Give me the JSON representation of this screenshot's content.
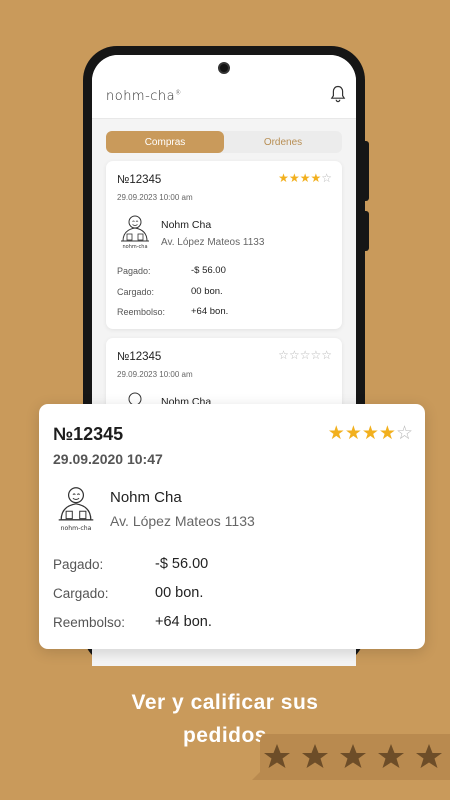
{
  "app": {
    "logo_text": "nohm-cha"
  },
  "tabs": [
    {
      "label": "Compras",
      "active": true
    },
    {
      "label": "Ordenes",
      "active": false
    }
  ],
  "orders": [
    {
      "number": "№12345",
      "rating": 4,
      "date": "29.09.2023 10:00 am",
      "shop": "Nohm Cha",
      "address": "Av. López Mateos 1133",
      "rows": [
        {
          "label": "Pagado:",
          "value": "-$ 56.00"
        },
        {
          "label": "Cargado:",
          "value": "00 bon."
        },
        {
          "label": "Reembolso:",
          "value": "+64 bon."
        }
      ]
    },
    {
      "number": "№12345",
      "rating": 0,
      "date": "29.09.2023 10:00 am",
      "shop": "Nohm Cha"
    }
  ],
  "detail": {
    "number": "№12345",
    "rating": 4,
    "date": "29.09.2020 10:47",
    "shop": "Nohm Cha",
    "address": "Av. López Mateos 1133",
    "rows": [
      {
        "label": "Pagado:",
        "value": "-$ 56.00"
      },
      {
        "label": "Cargado:",
        "value": "00 bon."
      },
      {
        "label": "Reembolso:",
        "value": "+64 bon."
      }
    ]
  },
  "caption": {
    "line1": "Ver y calificar sus",
    "line2": "pedidos"
  },
  "colors": {
    "background": "#c99a5b",
    "star": "#f2b01e",
    "accent": "#c99a5b"
  },
  "icons": {
    "notifications": "bell-icon",
    "mascot": "buddha-logo-icon"
  }
}
